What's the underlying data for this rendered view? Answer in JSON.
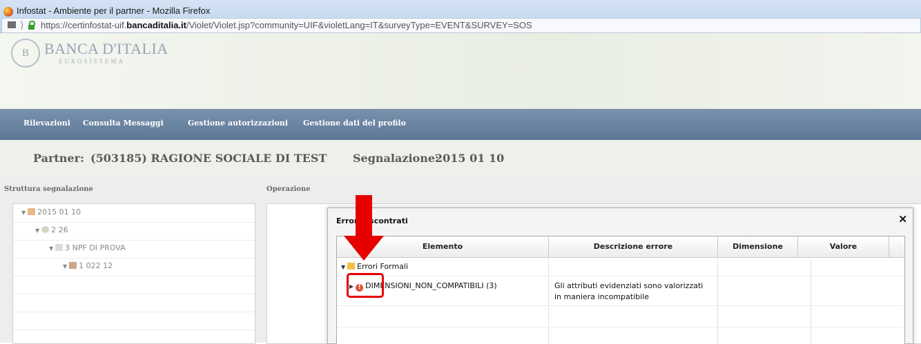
{
  "window": {
    "title": "Infostat - Ambiente per il partner - Mozilla Firefox",
    "url_prefix": "https://certinfostat-uif.",
    "url_domain": "bancaditalia.it",
    "url_suffix": "/Violet/Violet.jsp?community=UIF&violetLang=IT&surveyType=EVENT&SURVEY=SOS",
    "separator_glyph": "⟩"
  },
  "header": {
    "logo_initials": "B",
    "logo_name": "BANCA D'ITALIA",
    "logo_subtitle": "EUROSISTEMA"
  },
  "nav": {
    "items": [
      "Rilevazioni",
      "Consulta Messaggi",
      "Gestione autorizzazioni",
      "Gestione dati del profilo"
    ]
  },
  "info": {
    "partner_label": "Partner:",
    "partner_value": "(503185) RAGIONE SOCIALE DI TEST",
    "segnalazione_label": "Segnalazione:",
    "segnalazione_value": "2015 01 10"
  },
  "left_panel": {
    "title": "Struttura segnalazione",
    "tree": [
      {
        "label": "2015 01 10"
      },
      {
        "label": "2 26"
      },
      {
        "label": "3 NPF DI PROVA"
      },
      {
        "label": "1 022 12"
      }
    ]
  },
  "right_panel": {
    "title": "Operazione"
  },
  "dialog": {
    "title": "Errori riscontrati",
    "close_glyph": "✕",
    "columns": [
      "Elemento",
      "Descrizione errore",
      "Dimensione",
      "Valore"
    ],
    "rows": [
      {
        "element": "Errori Formali",
        "description": "",
        "dimension": "",
        "value": ""
      },
      {
        "element": "DIMENSIONI_NON_COMPATIBILI (3)",
        "description_line1": "Gli attributi evidenziati sono valorizzati",
        "description_line2": "in maniera incompatibile",
        "icon_glyph": "!"
      }
    ]
  },
  "colors": {
    "nav_bar": "#6a84a3",
    "annotation": "#e60000",
    "error_icon": "#e0533f"
  }
}
